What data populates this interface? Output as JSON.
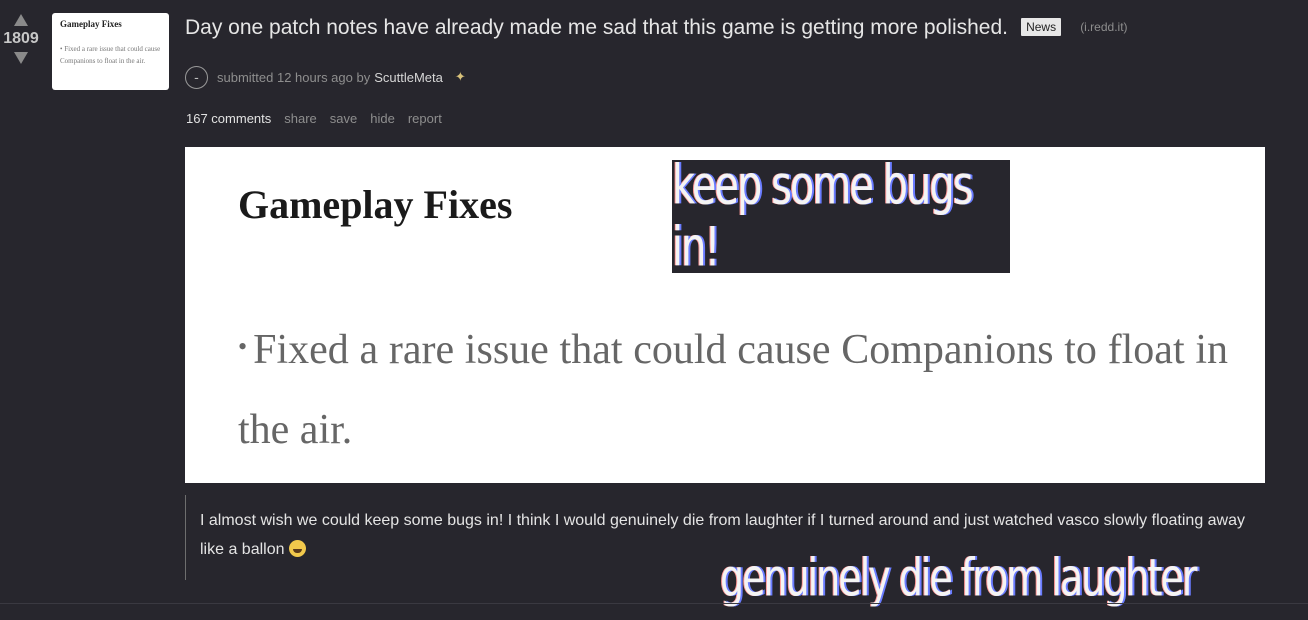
{
  "post": {
    "score": "1809",
    "title": "Day one patch notes have already made me sad that this game is getting more polished.",
    "flair": "News",
    "domain": "(i.redd.it)",
    "expando_symbol": "-",
    "submitted_text": "submitted 12 hours ago by",
    "author": "ScuttleMeta",
    "buttons": {
      "comments": "167 comments",
      "share": "share",
      "save": "save",
      "hide": "hide",
      "report": "report"
    },
    "selftext": "I almost wish we could keep some bugs in! I think I would genuinely die from laughter if I turned around and just watched vasco slowly floating away like a ballon",
    "emoji_icon": "laughing-tears-emoji"
  },
  "thumbnail": {
    "title": "Gameplay Fixes",
    "body": "• Fixed a rare issue that could cause Companions to float in the air."
  },
  "image": {
    "title": "Gameplay Fixes",
    "bullet": "•",
    "body": "Fixed a rare issue that could cause Companions to float in the air."
  },
  "captions": {
    "top": "keep some bugs in!",
    "bottom": "genuinely die from laughter"
  },
  "colors": {
    "background": "#27262d",
    "caption_text": "#f4f4f4"
  }
}
